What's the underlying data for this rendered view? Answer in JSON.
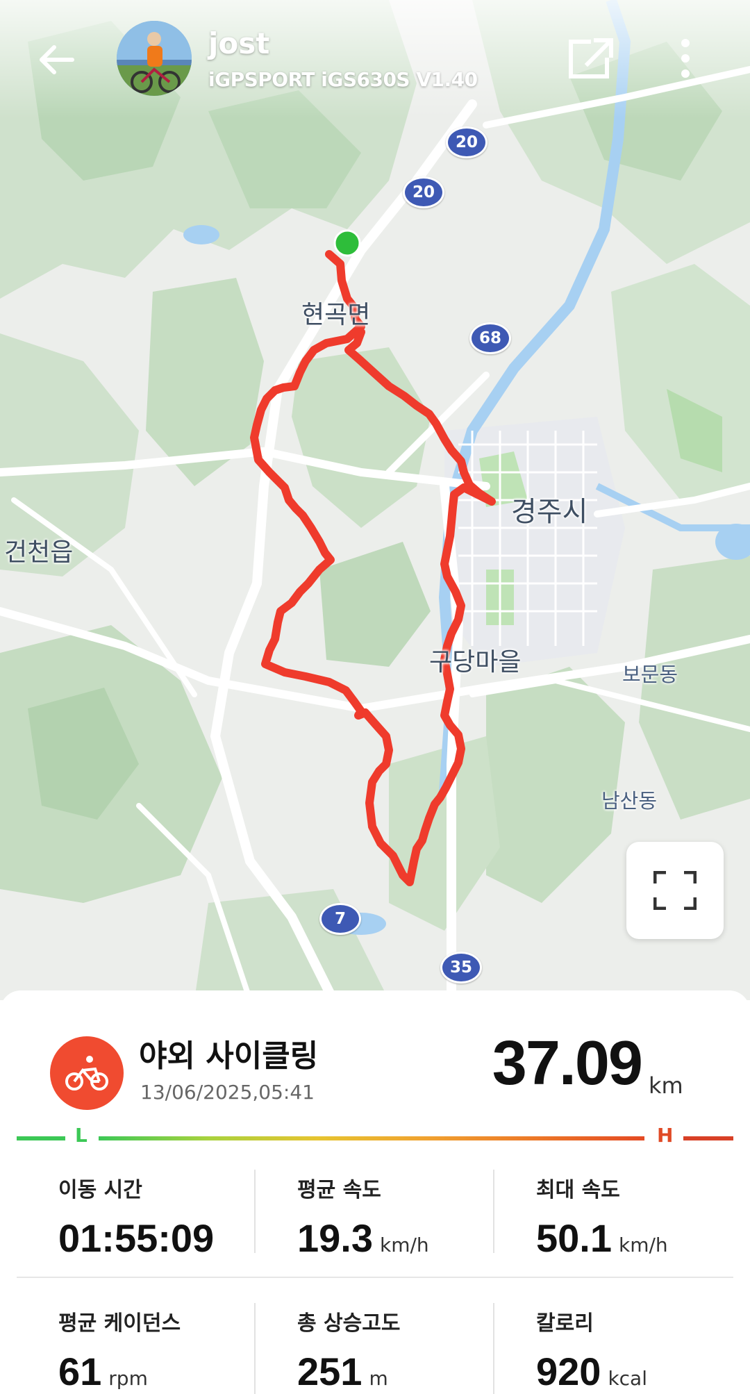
{
  "header": {
    "username": "jost",
    "device": "iGPSPORT iGS630S  V1.40"
  },
  "map": {
    "labels": {
      "hyeongok": "현곡면",
      "gyeongju": "경주시",
      "geoncheon": "건천읍",
      "gudang": "구당마을",
      "bomun": "보문동",
      "namsan": "남산동"
    },
    "shields": {
      "r20a": "20",
      "r20b": "20",
      "r68": "68",
      "r7": "7",
      "r35": "35"
    },
    "route_color": "#ef3b2c",
    "start_marker_color": "#2ebd3a"
  },
  "activity": {
    "name": "야외 사이클링",
    "datetime": "13/06/2025,05:41",
    "distance": "37.09",
    "distance_unit": "km",
    "scale_low": "L",
    "scale_high": "H"
  },
  "stats": [
    {
      "label": "이동 시간",
      "value": "01:55:09",
      "unit": ""
    },
    {
      "label": "평균 속도",
      "value": "19.3",
      "unit": "km/h"
    },
    {
      "label": "최대 속도",
      "value": "50.1",
      "unit": "km/h"
    },
    {
      "label": "평균 케이던스",
      "value": "61",
      "unit": "rpm"
    },
    {
      "label": "총 상승고도",
      "value": "251",
      "unit": "m"
    },
    {
      "label": "칼로리",
      "value": "920",
      "unit": "kcal"
    }
  ]
}
